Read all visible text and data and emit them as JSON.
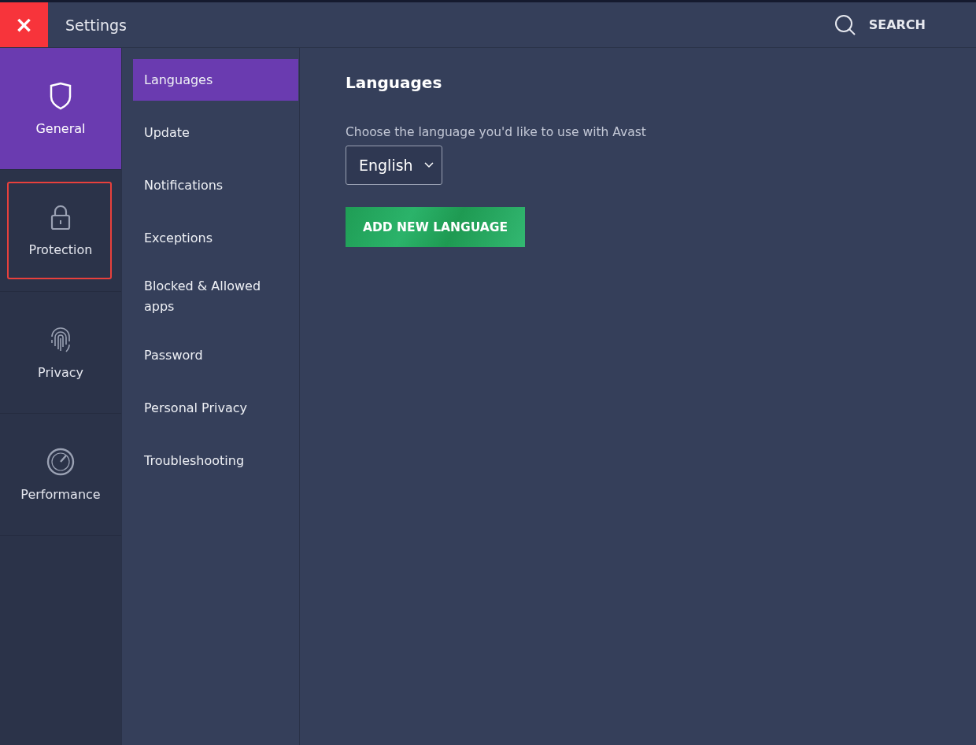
{
  "window": {
    "title": "Settings",
    "close": "×"
  },
  "search": {
    "label": "SEARCH"
  },
  "categories": [
    {
      "label": "General",
      "selected": true,
      "highlighted": false
    },
    {
      "label": "Protection",
      "selected": false,
      "highlighted": true
    },
    {
      "label": "Privacy",
      "selected": false,
      "highlighted": false
    },
    {
      "label": "Performance",
      "selected": false,
      "highlighted": false
    }
  ],
  "subsections": [
    {
      "label": "Languages",
      "selected": true
    },
    {
      "label": "Update",
      "selected": false
    },
    {
      "label": "Notifications",
      "selected": false
    },
    {
      "label": "Exceptions",
      "selected": false
    },
    {
      "label": "Blocked & Allowed apps",
      "selected": false
    },
    {
      "label": "Password",
      "selected": false
    },
    {
      "label": "Personal Privacy",
      "selected": false
    },
    {
      "label": "Troubleshooting",
      "selected": false
    }
  ],
  "content": {
    "heading": "Languages",
    "description": "Choose the language you'd like to use with Avast",
    "language_select": {
      "value": "English"
    },
    "add_button": "ADD NEW LANGUAGE"
  }
}
